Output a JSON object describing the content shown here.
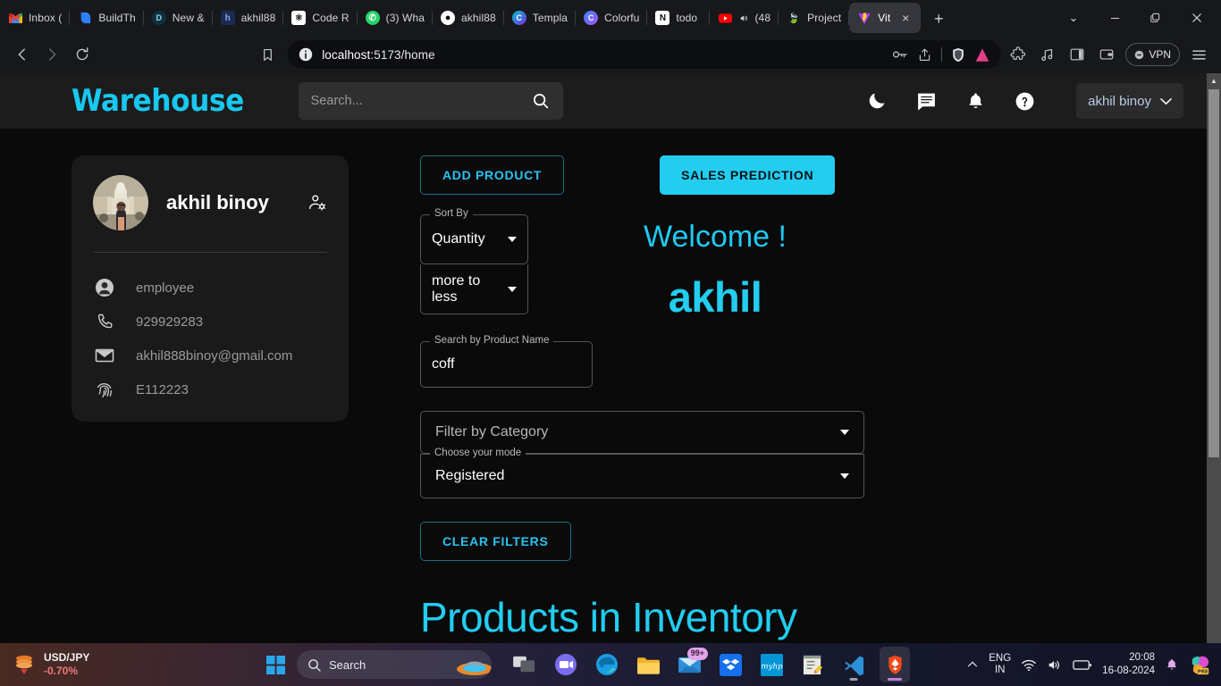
{
  "browser": {
    "tabs": [
      {
        "title": "Inbox (",
        "icon": "gmail-icon"
      },
      {
        "title": "BuildTh",
        "icon": "buildthis-icon"
      },
      {
        "title": "New &",
        "icon": "docs-icon"
      },
      {
        "title": "akhil88",
        "icon": "hashnode-icon"
      },
      {
        "title": "Code R",
        "icon": "chatgpt-icon"
      },
      {
        "title": "(3) Wha",
        "icon": "whatsapp-icon"
      },
      {
        "title": "akhil88",
        "icon": "github-icon"
      },
      {
        "title": "Templa",
        "icon": "canva-icon"
      },
      {
        "title": "Colorfu",
        "icon": "coolors-icon"
      },
      {
        "title": "todo",
        "icon": "notion-icon"
      },
      {
        "title": "(48",
        "icon": "youtube-icon"
      },
      {
        "title": "Project",
        "icon": "leaf-icon"
      },
      {
        "title": "Vit",
        "icon": "vite-icon",
        "active": true
      }
    ],
    "new_tab_label": "+",
    "tab_close_label": "×",
    "tab_list_label": "⌄",
    "window": {
      "minimize": "—",
      "maximize": "❐",
      "close": "×"
    },
    "nav": {
      "back": "back-arrow",
      "forward": "forward-arrow",
      "reload": "reload-icon",
      "bookmark": "bookmark-icon"
    },
    "address": {
      "prefix": "localhost",
      "rest": ":5173/home",
      "full": "localhost:5173/home"
    },
    "toolbar": {
      "password_icon": "key-icon",
      "share_icon": "share-icon",
      "shield_icon": "brave-shield-icon",
      "brave_rewards_icon": "brave-triangle-icon",
      "extensions_icon": "puzzle-icon",
      "music_icon": "music-icon",
      "sidebar_icon": "sidebar-icon",
      "wallet_icon": "wallet-icon",
      "vpn_label": "VPN",
      "menu_icon": "hamburger-icon"
    }
  },
  "app": {
    "brand": "Warehouse",
    "search": {
      "placeholder": "Search...",
      "icon": "search-icon"
    },
    "header_icons": [
      "moon-icon",
      "chat-icon",
      "bell-icon",
      "help-icon"
    ],
    "user_chip": {
      "name": "akhil binoy",
      "caret": "chevron-down-icon"
    }
  },
  "profile": {
    "name": "akhil binoy",
    "manage_icon": "manage-account-icon",
    "avatar": "user-photo-avatar",
    "rows": [
      {
        "icon": "person-icon",
        "text": "employee"
      },
      {
        "icon": "phone-icon",
        "text": "929929283"
      },
      {
        "icon": "email-icon",
        "text": "akhil888binoy@gmail.com"
      },
      {
        "icon": "fingerprint-icon",
        "text": "E112223"
      }
    ]
  },
  "main": {
    "add_product_label": "ADD PRODUCT",
    "sales_prediction_label": "SALES PREDICTION",
    "sort_by": {
      "legend": "Sort By",
      "value": "Quantity"
    },
    "sort_order": {
      "value": "more to less"
    },
    "welcome": {
      "line1": "Welcome !",
      "line2": "akhil"
    },
    "product_search": {
      "legend": "Search by Product Name",
      "value": "coff"
    },
    "category": {
      "placeholder": "Filter by Category"
    },
    "mode": {
      "legend": "Choose your mode",
      "value": "Registered"
    },
    "clear_filters_label": "CLEAR FILTERS",
    "products_title": "Products in Inventory"
  },
  "colors": {
    "accent": "#22cdf0",
    "page_bg": "#0a0a0a",
    "header_bg": "#1c1c1c",
    "card_bg": "#1a1a1a"
  },
  "taskbar": {
    "widget": {
      "pair": "USD/JPY",
      "change": "-0.70%",
      "icon": "stock-down-icon"
    },
    "start_icon": "windows-start-icon",
    "search_placeholder": "Search",
    "search_icon": "search-icon",
    "apps": [
      {
        "name": "task-view-icon"
      },
      {
        "name": "meet-icon"
      },
      {
        "name": "edge-icon"
      },
      {
        "name": "file-explorer-icon"
      },
      {
        "name": "mail-icon",
        "badge": "99+"
      },
      {
        "name": "dropbox-icon"
      },
      {
        "name": "myhp-icon"
      },
      {
        "name": "notepad-icon"
      },
      {
        "name": "vscode-icon"
      },
      {
        "name": "brave-icon"
      }
    ],
    "tray": {
      "chevron": "chevron-up-icon",
      "lang_line1": "ENG",
      "lang_line2": "IN",
      "wifi": "wifi-icon",
      "volume": "volume-icon",
      "battery": "battery-icon",
      "time": "20:08",
      "date": "16-08-2024",
      "bell": "bell-icon",
      "copilot": "copilot-pre-icon"
    }
  }
}
